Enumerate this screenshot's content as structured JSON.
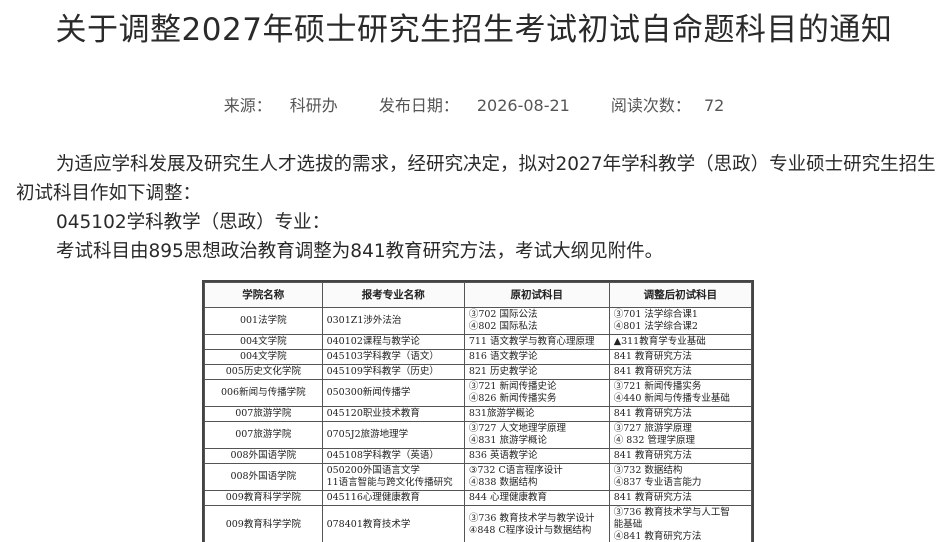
{
  "article": {
    "title": "关于调整2027年硕士研究生招生考试初试自命题科目的通知",
    "meta": {
      "source_label": "来源：",
      "source": "科研办",
      "date_label": "发布日期：",
      "date": "2026-08-21",
      "views_label": "阅读次数：",
      "views": "72"
    },
    "paragraphs": [
      "为适应学科发展及研究生人才选拔的需求，经研究决定，拟对2027年学科教学（思政）专业硕士研究生招生初试科目作如下调整：",
      "045102学科教学（思政）专业：",
      "考试科目由895思想政治教育调整为841教育研究方法，考试大纲见附件。"
    ]
  },
  "table": {
    "headers": [
      "学院名称",
      "报考专业名称",
      "原初试科目",
      "调整后初试科目"
    ],
    "rows": [
      [
        [
          "001法学院"
        ],
        [
          "0301Z1涉外法治"
        ],
        [
          "③702 国际公法",
          "④802 国际私法"
        ],
        [
          "③701 法学综合课1",
          "④801 法学综合课2"
        ]
      ],
      [
        [
          "004文学院"
        ],
        [
          "040102课程与教学论"
        ],
        [
          "711 语文教学与教育心理原理"
        ],
        [
          "▲311教育学专业基础"
        ]
      ],
      [
        [
          "004文学院"
        ],
        [
          "045103学科教学（语文）"
        ],
        [
          "816 语文教学论"
        ],
        [
          "841 教育研究方法"
        ]
      ],
      [
        [
          "005历史文化学院"
        ],
        [
          "045109学科教学（历史）"
        ],
        [
          "821 历史教学论"
        ],
        [
          "841 教育研究方法"
        ]
      ],
      [
        [
          "006新闻与传播学院"
        ],
        [
          "050300新闻传播学"
        ],
        [
          "③721 新闻传播史论",
          "④826 新闻传播实务"
        ],
        [
          "③721 新闻传播实务",
          "④440 新闻与传播专业基础"
        ]
      ],
      [
        [
          "007旅游学院"
        ],
        [
          "045120职业技术教育"
        ],
        [
          "831旅游学概论"
        ],
        [
          "841 教育研究方法"
        ]
      ],
      [
        [
          "007旅游学院"
        ],
        [
          "0705J2旅游地理学"
        ],
        [
          "③727 人文地理学原理",
          "④831 旅游学概论"
        ],
        [
          "③727 旅游学原理",
          "④ 832 管理学原理"
        ]
      ],
      [
        [
          "008外国语学院"
        ],
        [
          "045108学科教学（英语）"
        ],
        [
          "836 英语教学论"
        ],
        [
          "841 教育研究方法"
        ]
      ],
      [
        [
          "008外国语学院"
        ],
        [
          "050200外国语言文学",
          "11语言智能与跨文化传播研究"
        ],
        [
          "③732 C语言程序设计",
          "④838 数据结构"
        ],
        [
          "③732 数据结构",
          "④837 专业语言能力"
        ]
      ],
      [
        [
          "009教育科学学院"
        ],
        [
          "045116心理健康教育"
        ],
        [
          "844 心理健康教育"
        ],
        [
          "841 教育研究方法"
        ]
      ],
      [
        [
          "009教育科学学院"
        ],
        [
          "078401教育技术学"
        ],
        [
          "③736 教育技术学与教学设计",
          "④848 C程序设计与数据结构"
        ],
        [
          "③736 教育技术学与人工智",
          "能基础",
          "④841 教育研究方法"
        ]
      ]
    ]
  }
}
